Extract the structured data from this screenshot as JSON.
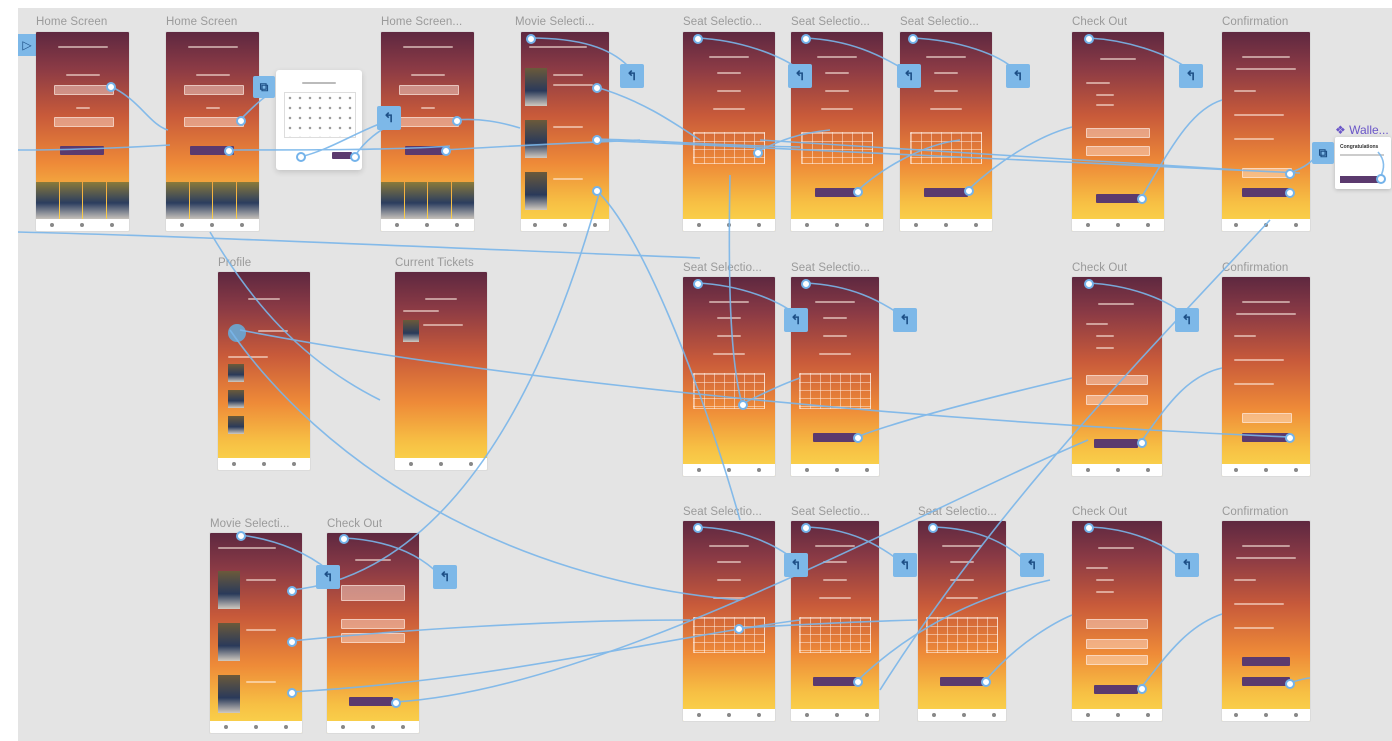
{
  "canvas": {
    "background": "#e4e4e4",
    "wire_color": "#74b3ea",
    "button_color": "#5b3a6e"
  },
  "artboard_titles": {
    "home_1": "Home Screen",
    "home_2": "Home Screen",
    "home_3": "Home Screen...",
    "movie_1": "Movie Selecti...",
    "seat_r1_1": "Seat Selectio...",
    "seat_r1_2": "Seat Selectio...",
    "seat_r1_3": "Seat Selectio...",
    "checkout_r1": "Check Out",
    "confirm_r1": "Confirmation",
    "profile": "Profile",
    "current_tickets": "Current Tickets",
    "seat_r2_1": "Seat Selectio...",
    "seat_r2_2": "Seat Selectio...",
    "checkout_r2": "Check Out",
    "confirm_r2": "Confirmation",
    "movie_2": "Movie Selecti...",
    "checkout_r3a": "Check Out",
    "seat_r3_1": "Seat Selectio...",
    "seat_r3_2": "Seat Selectio...",
    "seat_r3_3": "Seat Selectio...",
    "checkout_r3b": "Check Out",
    "confirm_r3": "Confirmation"
  },
  "success_card": {
    "wallet_label": "❖ Walle...",
    "title": "Congratulations"
  },
  "icons": {
    "start": "play-triangle-icon",
    "back": "back-arrow-icon",
    "overlay": "overlay-trigger-icon"
  }
}
